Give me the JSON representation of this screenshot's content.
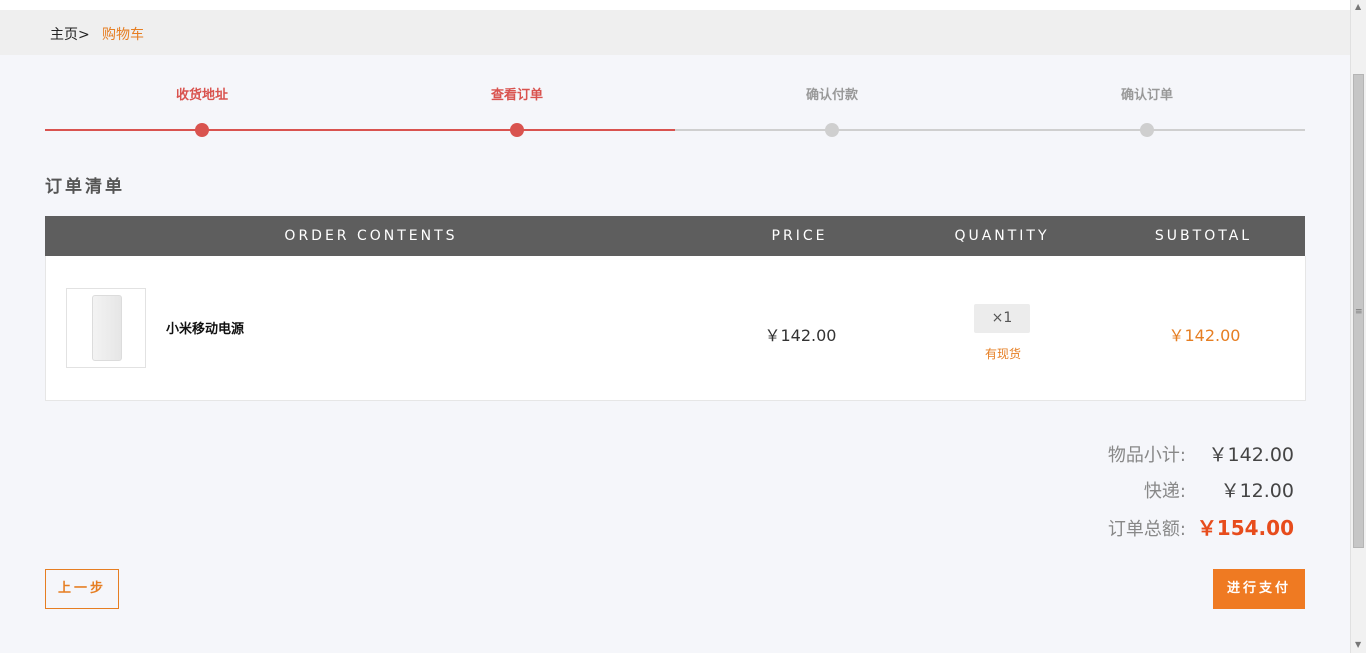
{
  "breadcrumb": {
    "home": "主页>",
    "current": "购物车"
  },
  "steps": [
    {
      "label": "收货地址",
      "state": "active"
    },
    {
      "label": "查看订单",
      "state": "active"
    },
    {
      "label": "确认付款",
      "state": "pending"
    },
    {
      "label": "确认订单",
      "state": "pending"
    }
  ],
  "section_title": "订单清单",
  "table": {
    "headers": {
      "contents": "ORDER CONTENTS",
      "price": "PRICE",
      "quantity": "QUANTITY",
      "subtotal": "SUBTOTAL"
    },
    "rows": [
      {
        "name": "小米移动电源",
        "price": "￥142.00",
        "quantity": "×1",
        "stock": "有现货",
        "subtotal": "￥142.00"
      }
    ]
  },
  "summary": {
    "items_label": "物品小计:",
    "items_value": "￥142.00",
    "shipping_label": "快递:",
    "shipping_value": "￥12.00",
    "total_label": "订单总额:",
    "total_value": "￥154.00"
  },
  "buttons": {
    "prev": "上一步",
    "pay": "进行支付"
  },
  "colors": {
    "accent": "#e67e22",
    "step_active": "#d9534f",
    "step_pending": "#cfcfcf",
    "header_bg": "#5e5e5e",
    "total": "#e74c1c"
  },
  "icons": {
    "product_thumb": "power-bank-image",
    "scroll_up": "arrow-up-icon",
    "scroll_down": "arrow-down-icon"
  }
}
